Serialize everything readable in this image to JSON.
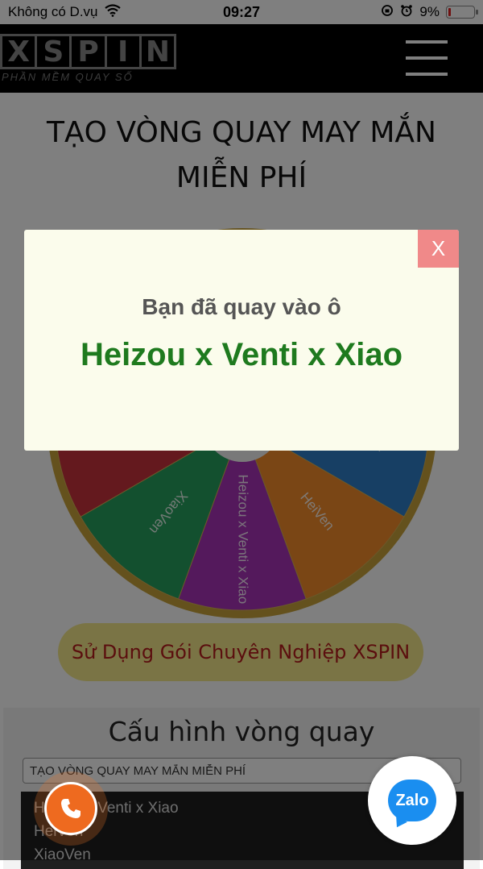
{
  "status_bar": {
    "carrier": "Không có D.vụ",
    "time": "09:27",
    "battery": "9%"
  },
  "header": {
    "logo_letters": [
      "X",
      "S",
      "P",
      "I",
      "N"
    ],
    "logo_subtitle": "PHẦN MỀM QUAY SỐ"
  },
  "page": {
    "title": "TẠO VÒNG QUAY MAY MẮN MIỄN PHÍ",
    "promo_button": "Sử Dụng Gói Chuyên Nghiệp XSPIN"
  },
  "wheel": {
    "segments": [
      {
        "label": "Heizou x Venti x Xiao",
        "color": "#a832b8"
      },
      {
        "label": "XiaoVen",
        "color": "#27a05f"
      },
      {
        "label": "HeiVen",
        "color": "#c8323c"
      },
      {
        "label": "Heizou x Venti x Xiao",
        "color": "#2e7fc8"
      },
      {
        "label": "XiaoVen",
        "color": "#f0b533"
      },
      {
        "label": "HeiVen",
        "color": "#e07a2a"
      },
      {
        "label": "Heizou x Venti x Xiao",
        "color": "#27a05f"
      },
      {
        "label": "XiaoVen",
        "color": "#2e7fc8"
      },
      {
        "label": "HeiVen",
        "color": "#f58c2a"
      }
    ]
  },
  "config": {
    "title": "Cấu hình vòng quay",
    "input_value": "TẠO VÒNG QUAY MAY MẮN MIỄN PHÍ",
    "items": [
      "Heizou x Venti x Xiao",
      "HeiVen",
      "XiaoVen"
    ]
  },
  "modal": {
    "close_label": "X",
    "message": "Bạn đã quay vào ô",
    "result": "Heizou x Venti x Xiao"
  },
  "floating": {
    "zalo_label": "Zalo"
  }
}
